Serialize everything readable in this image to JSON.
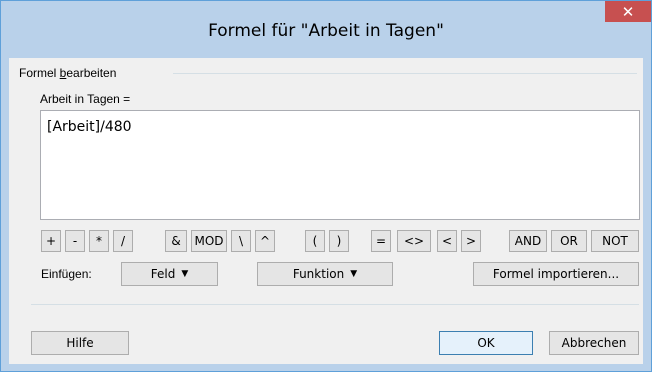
{
  "window": {
    "title": "Formel für \"Arbeit in Tagen\"",
    "close_symbol": "✕"
  },
  "group": {
    "label_pre": "Formel ",
    "label_underlined": "b",
    "label_post": "earbeiten"
  },
  "formula": {
    "label": "Arbeit in Tagen =",
    "value": "[Arbeit]/480"
  },
  "operators": [
    "+",
    "-",
    "*",
    "/",
    "&",
    "MOD",
    "\\",
    "^",
    "(",
    ")",
    "=",
    "<>",
    "<",
    ">",
    "AND",
    "OR",
    "NOT"
  ],
  "insert": {
    "label": "Einfügen:",
    "field_button": "Feld",
    "function_button": "Funktion",
    "import_button": "Formel importieren...",
    "dropdown_arrow": "▼"
  },
  "footer": {
    "help_button": "Hilfe",
    "ok_button": "OK",
    "cancel_button": "Abbrechen"
  },
  "colors": {
    "title_bar": "#b9d1ea",
    "close_button": "#c75050",
    "dialog_body": "#f0f0f0"
  }
}
